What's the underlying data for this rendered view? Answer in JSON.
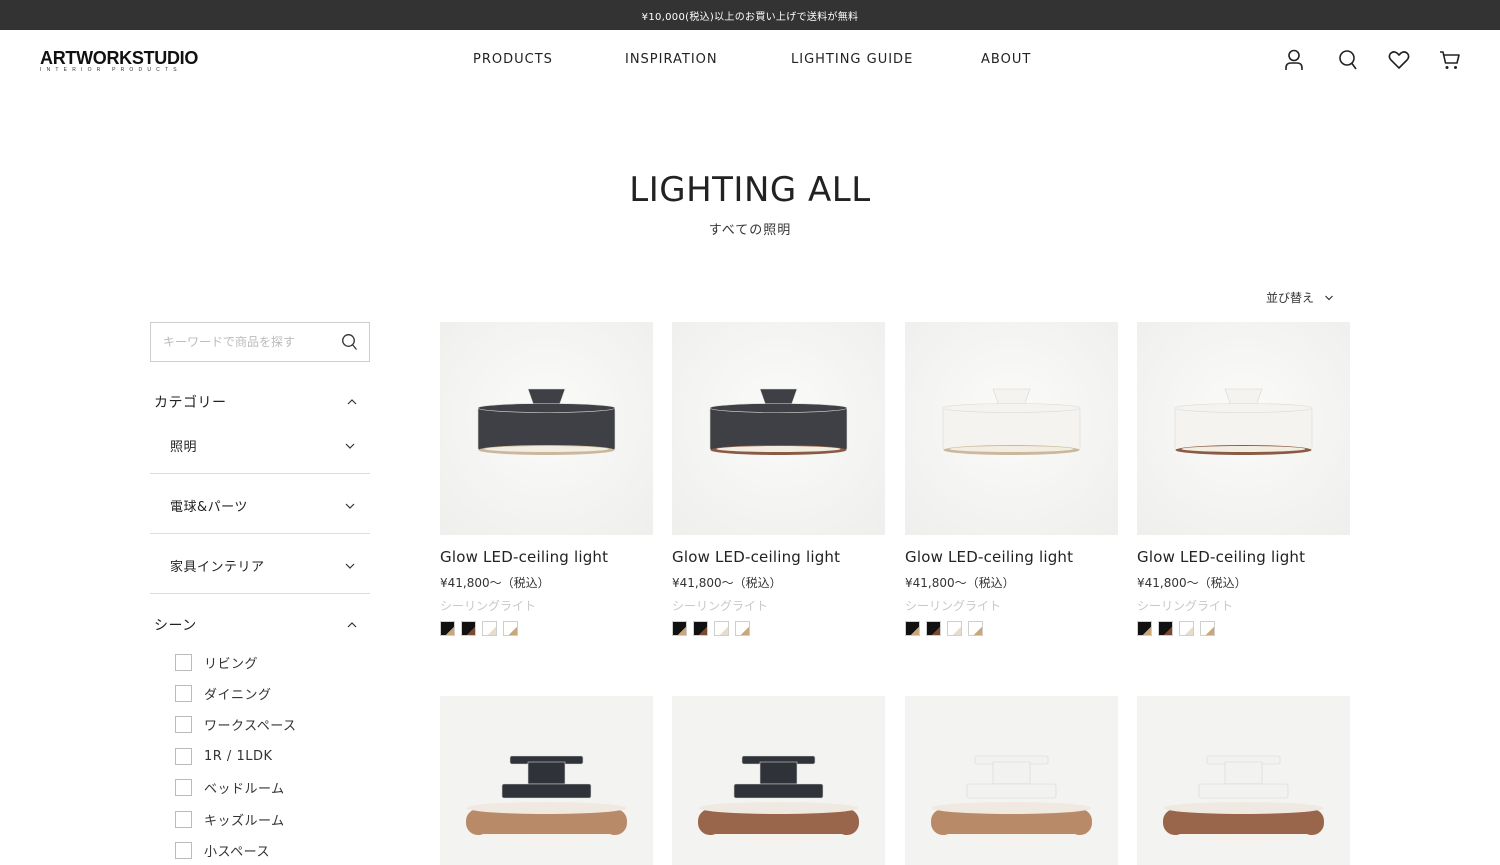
{
  "announcement": "¥10,000(税込)以上のお買い上げで送料が無料",
  "brand": {
    "name": "ARTWORKSTUDIO",
    "tagline": "INTERIOR PRODUCTS"
  },
  "nav": [
    "PRODUCTS",
    "INSPIRATION",
    "LIGHTING GUIDE",
    "ABOUT"
  ],
  "header_icons": [
    "user-icon",
    "search-icon",
    "heart-icon",
    "cart-icon"
  ],
  "page": {
    "title": "LIGHTING ALL",
    "subtitle": "すべての照明"
  },
  "sort": {
    "label": "並び替え"
  },
  "search": {
    "placeholder": "キーワードで商品を探す",
    "value": ""
  },
  "filters": {
    "category": {
      "label": "カテゴリー",
      "expanded": true,
      "items": [
        "照明",
        "電球&パーツ",
        "家具インテリア"
      ]
    },
    "scene": {
      "label": "シーン",
      "expanded": true,
      "options": [
        "リビング",
        "ダイニング",
        "ワークスペース",
        "1R / 1LDK",
        "ベッドルーム",
        "キッズルーム",
        "小スペース"
      ]
    }
  },
  "products": [
    {
      "name": "Glow LED-ceiling light",
      "price": "¥41,800〜（税込）",
      "category": "シーリングライト",
      "shade_color": "#3e4045",
      "rim_color": "#c9b89c"
    },
    {
      "name": "Glow LED-ceiling light",
      "price": "¥41,800〜（税込）",
      "category": "シーリングライト",
      "shade_color": "#3e4045",
      "rim_color": "#8a5b44"
    },
    {
      "name": "Glow LED-ceiling light",
      "price": "¥41,800〜（税込）",
      "category": "シーリングライト",
      "shade_color": "#f4f3f0",
      "rim_color": "#c9b89c"
    },
    {
      "name": "Glow LED-ceiling light",
      "price": "¥41,800〜（税込）",
      "category": "シーリングライト",
      "shade_color": "#f4f3f0",
      "rim_color": "#8a5b44"
    }
  ],
  "swatch_colors": [
    {
      "base": "#111111",
      "accent": "#c9a77a"
    },
    {
      "base": "#111111",
      "accent": "#7a4a30"
    },
    {
      "base": "#ffffff",
      "accent": "#e6dccb"
    },
    {
      "base": "#ffffff",
      "accent": "#c9a77a"
    }
  ],
  "products_row2": [
    {
      "fixture_color": "#2f3238",
      "wood_color": "#b88a68"
    },
    {
      "fixture_color": "#2f3238",
      "wood_color": "#9a664b"
    },
    {
      "fixture_color": "#f2f2f0",
      "wood_color": "#b88a68"
    },
    {
      "fixture_color": "#f2f2f0",
      "wood_color": "#9a664b"
    }
  ]
}
